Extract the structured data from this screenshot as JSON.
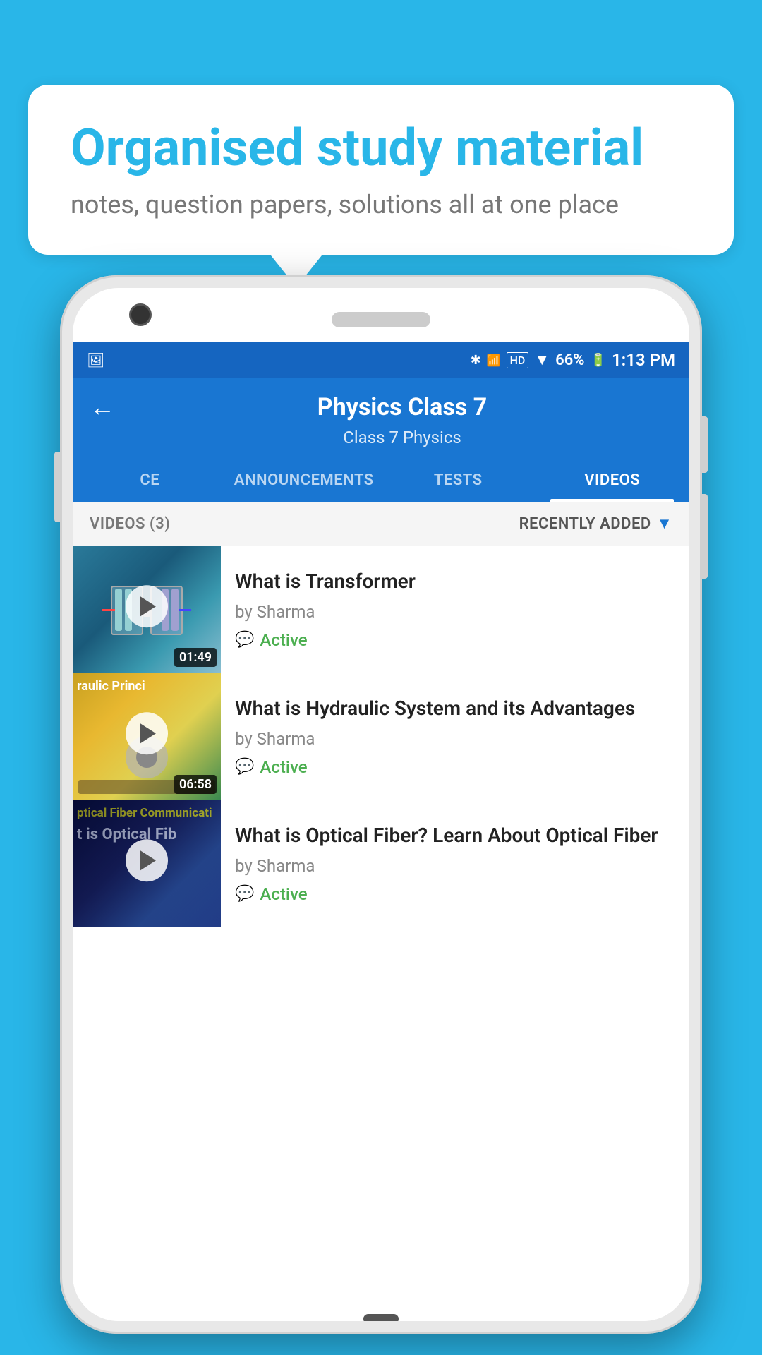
{
  "page": {
    "background_color": "#29b6e8"
  },
  "speech_bubble": {
    "title": "Organised study material",
    "subtitle": "notes, question papers, solutions all at one place"
  },
  "phone": {
    "status_bar": {
      "time": "1:13 PM",
      "battery": "66%",
      "signal_icons": "🔷📶"
    },
    "app_bar": {
      "back_label": "←",
      "title": "Physics Class 7",
      "breadcrumb": "Class 7   Physics"
    },
    "tabs": [
      {
        "label": "CE",
        "active": false
      },
      {
        "label": "ANNOUNCEMENTS",
        "active": false
      },
      {
        "label": "TESTS",
        "active": false
      },
      {
        "label": "VIDEOS",
        "active": true
      }
    ],
    "videos_header": {
      "count_label": "VIDEOS (3)",
      "sort_label": "RECENTLY ADDED"
    },
    "videos": [
      {
        "title": "What is  Transformer",
        "author": "by Sharma",
        "status": "Active",
        "duration": "01:49",
        "thumb_type": "transformer"
      },
      {
        "title": "What is Hydraulic System and its Advantages",
        "author": "by Sharma",
        "status": "Active",
        "duration": "06:58",
        "thumb_type": "hydraulic"
      },
      {
        "title": "What is Optical Fiber? Learn About Optical Fiber",
        "author": "by Sharma",
        "status": "Active",
        "duration": "",
        "thumb_type": "optical"
      }
    ]
  }
}
